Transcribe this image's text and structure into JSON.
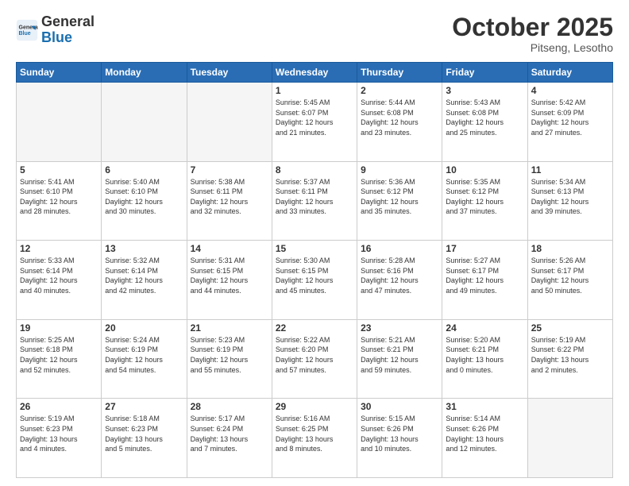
{
  "header": {
    "logo_general": "General",
    "logo_blue": "Blue",
    "month": "October 2025",
    "location": "Pitseng, Lesotho"
  },
  "weekdays": [
    "Sunday",
    "Monday",
    "Tuesday",
    "Wednesday",
    "Thursday",
    "Friday",
    "Saturday"
  ],
  "weeks": [
    [
      {
        "day": "",
        "info": ""
      },
      {
        "day": "",
        "info": ""
      },
      {
        "day": "",
        "info": ""
      },
      {
        "day": "1",
        "info": "Sunrise: 5:45 AM\nSunset: 6:07 PM\nDaylight: 12 hours\nand 21 minutes."
      },
      {
        "day": "2",
        "info": "Sunrise: 5:44 AM\nSunset: 6:08 PM\nDaylight: 12 hours\nand 23 minutes."
      },
      {
        "day": "3",
        "info": "Sunrise: 5:43 AM\nSunset: 6:08 PM\nDaylight: 12 hours\nand 25 minutes."
      },
      {
        "day": "4",
        "info": "Sunrise: 5:42 AM\nSunset: 6:09 PM\nDaylight: 12 hours\nand 27 minutes."
      }
    ],
    [
      {
        "day": "5",
        "info": "Sunrise: 5:41 AM\nSunset: 6:10 PM\nDaylight: 12 hours\nand 28 minutes."
      },
      {
        "day": "6",
        "info": "Sunrise: 5:40 AM\nSunset: 6:10 PM\nDaylight: 12 hours\nand 30 minutes."
      },
      {
        "day": "7",
        "info": "Sunrise: 5:38 AM\nSunset: 6:11 PM\nDaylight: 12 hours\nand 32 minutes."
      },
      {
        "day": "8",
        "info": "Sunrise: 5:37 AM\nSunset: 6:11 PM\nDaylight: 12 hours\nand 33 minutes."
      },
      {
        "day": "9",
        "info": "Sunrise: 5:36 AM\nSunset: 6:12 PM\nDaylight: 12 hours\nand 35 minutes."
      },
      {
        "day": "10",
        "info": "Sunrise: 5:35 AM\nSunset: 6:12 PM\nDaylight: 12 hours\nand 37 minutes."
      },
      {
        "day": "11",
        "info": "Sunrise: 5:34 AM\nSunset: 6:13 PM\nDaylight: 12 hours\nand 39 minutes."
      }
    ],
    [
      {
        "day": "12",
        "info": "Sunrise: 5:33 AM\nSunset: 6:14 PM\nDaylight: 12 hours\nand 40 minutes."
      },
      {
        "day": "13",
        "info": "Sunrise: 5:32 AM\nSunset: 6:14 PM\nDaylight: 12 hours\nand 42 minutes."
      },
      {
        "day": "14",
        "info": "Sunrise: 5:31 AM\nSunset: 6:15 PM\nDaylight: 12 hours\nand 44 minutes."
      },
      {
        "day": "15",
        "info": "Sunrise: 5:30 AM\nSunset: 6:15 PM\nDaylight: 12 hours\nand 45 minutes."
      },
      {
        "day": "16",
        "info": "Sunrise: 5:28 AM\nSunset: 6:16 PM\nDaylight: 12 hours\nand 47 minutes."
      },
      {
        "day": "17",
        "info": "Sunrise: 5:27 AM\nSunset: 6:17 PM\nDaylight: 12 hours\nand 49 minutes."
      },
      {
        "day": "18",
        "info": "Sunrise: 5:26 AM\nSunset: 6:17 PM\nDaylight: 12 hours\nand 50 minutes."
      }
    ],
    [
      {
        "day": "19",
        "info": "Sunrise: 5:25 AM\nSunset: 6:18 PM\nDaylight: 12 hours\nand 52 minutes."
      },
      {
        "day": "20",
        "info": "Sunrise: 5:24 AM\nSunset: 6:19 PM\nDaylight: 12 hours\nand 54 minutes."
      },
      {
        "day": "21",
        "info": "Sunrise: 5:23 AM\nSunset: 6:19 PM\nDaylight: 12 hours\nand 55 minutes."
      },
      {
        "day": "22",
        "info": "Sunrise: 5:22 AM\nSunset: 6:20 PM\nDaylight: 12 hours\nand 57 minutes."
      },
      {
        "day": "23",
        "info": "Sunrise: 5:21 AM\nSunset: 6:21 PM\nDaylight: 12 hours\nand 59 minutes."
      },
      {
        "day": "24",
        "info": "Sunrise: 5:20 AM\nSunset: 6:21 PM\nDaylight: 13 hours\nand 0 minutes."
      },
      {
        "day": "25",
        "info": "Sunrise: 5:19 AM\nSunset: 6:22 PM\nDaylight: 13 hours\nand 2 minutes."
      }
    ],
    [
      {
        "day": "26",
        "info": "Sunrise: 5:19 AM\nSunset: 6:23 PM\nDaylight: 13 hours\nand 4 minutes."
      },
      {
        "day": "27",
        "info": "Sunrise: 5:18 AM\nSunset: 6:23 PM\nDaylight: 13 hours\nand 5 minutes."
      },
      {
        "day": "28",
        "info": "Sunrise: 5:17 AM\nSunset: 6:24 PM\nDaylight: 13 hours\nand 7 minutes."
      },
      {
        "day": "29",
        "info": "Sunrise: 5:16 AM\nSunset: 6:25 PM\nDaylight: 13 hours\nand 8 minutes."
      },
      {
        "day": "30",
        "info": "Sunrise: 5:15 AM\nSunset: 6:26 PM\nDaylight: 13 hours\nand 10 minutes."
      },
      {
        "day": "31",
        "info": "Sunrise: 5:14 AM\nSunset: 6:26 PM\nDaylight: 13 hours\nand 12 minutes."
      },
      {
        "day": "",
        "info": ""
      }
    ]
  ]
}
